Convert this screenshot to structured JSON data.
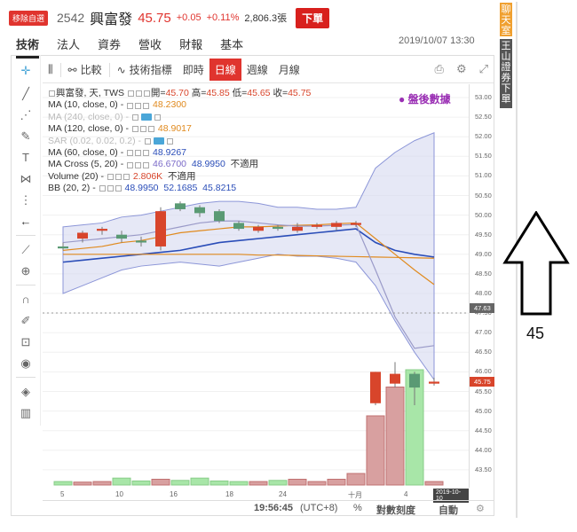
{
  "header": {
    "badge": "移除自選",
    "code": "2542",
    "name": "興富發",
    "price": "45.75",
    "change": "+0.05",
    "change_pct": "+0.11%",
    "volume": "2,806.3張",
    "order_button": "下單"
  },
  "tabs": [
    "技術",
    "法人",
    "資券",
    "營收",
    "財報",
    "基本"
  ],
  "active_tab": "技術",
  "timestamp": "2019/10/07 13:30",
  "toolbar": {
    "compare": "比較",
    "indicators": "技術指標",
    "intraday": "即時",
    "daily": "日線",
    "weekly": "週線",
    "monthly": "月線",
    "active": "日線"
  },
  "legend": {
    "main": {
      "title": "興富發, 天, TWS",
      "open_label": "開=",
      "open": "45.70",
      "high_label": "高=",
      "high": "45.85",
      "low_label": "低=",
      "low": "45.65",
      "close_label": "收=",
      "close": "45.75"
    },
    "rows": [
      {
        "label": "MA (10, close, 0)",
        "value": "48.2300",
        "color": "#e08a1e",
        "faded": false
      },
      {
        "label": "MA (240, close, 0)",
        "value": "",
        "faded": true
      },
      {
        "label": "MA (120, close, 0)",
        "value": "48.9017",
        "color": "#e08a1e",
        "faded": false
      },
      {
        "label": "SAR (0.02, 0.02, 0.2)",
        "value": "",
        "faded": true
      },
      {
        "label": "MA (60, close, 0)",
        "value": "48.9267",
        "color": "#2a4db8",
        "faded": false
      },
      {
        "label": "MA Cross (5, 20)",
        "value": "46.6700",
        "value2": "48.9950",
        "extra": "不適用",
        "faded": false
      },
      {
        "label": "Volume (20)",
        "value": "2.806K",
        "extra": "不適用",
        "faded": false
      },
      {
        "label": "BB (20, 2)",
        "value": "48.9950",
        "value2": "52.1685",
        "value3": "45.8215",
        "faded": false
      }
    ]
  },
  "after_hours": "盤後數據",
  "price_axis": [
    "53.00",
    "52.50",
    "52.00",
    "51.50",
    "51.00",
    "50.50",
    "50.00",
    "49.50",
    "49.00",
    "48.50",
    "48.00",
    "47.50",
    "47.00",
    "46.50",
    "46.00",
    "45.50",
    "45.00",
    "44.50",
    "44.00",
    "43.50"
  ],
  "price_axis_tags": {
    "crosshair": "47.63",
    "last": "45.75"
  },
  "time_axis": [
    "5",
    "10",
    "16",
    "18",
    "24",
    "十月",
    "4"
  ],
  "time_axis_tag": "2019-10-10",
  "bottombar": {
    "clock": "19:56:45",
    "tz": "(UTC+8)",
    "pct": "%",
    "log": "對數刻度",
    "auto": "自動"
  },
  "side_buttons": [
    "聊天室",
    "王山證券下單"
  ],
  "annotation": {
    "label": "45"
  },
  "colors": {
    "up": "#d8452b",
    "down": "#5a9a74",
    "accent": "#e0342e"
  },
  "chart_data": {
    "type": "candlestick",
    "candles": [
      {
        "o": 49.2,
        "h": 49.3,
        "l": 49.1,
        "c": 49.15
      },
      {
        "o": 49.4,
        "h": 49.6,
        "l": 49.3,
        "c": 49.55
      },
      {
        "o": 49.6,
        "h": 49.7,
        "l": 49.5,
        "c": 49.65
      },
      {
        "o": 49.5,
        "h": 49.6,
        "l": 49.3,
        "c": 49.4
      },
      {
        "o": 49.35,
        "h": 49.45,
        "l": 49.2,
        "c": 49.3
      },
      {
        "o": 49.2,
        "h": 50.2,
        "l": 49.1,
        "c": 50.1
      },
      {
        "o": 50.3,
        "h": 50.35,
        "l": 50.1,
        "c": 50.15
      },
      {
        "o": 50.2,
        "h": 50.25,
        "l": 49.95,
        "c": 50.05
      },
      {
        "o": 50.1,
        "h": 50.15,
        "l": 49.8,
        "c": 49.85
      },
      {
        "o": 49.8,
        "h": 49.85,
        "l": 49.6,
        "c": 49.65
      },
      {
        "o": 49.6,
        "h": 49.75,
        "l": 49.55,
        "c": 49.7
      },
      {
        "o": 49.7,
        "h": 49.75,
        "l": 49.6,
        "c": 49.65
      },
      {
        "o": 49.6,
        "h": 49.8,
        "l": 49.55,
        "c": 49.7
      },
      {
        "o": 49.7,
        "h": 49.8,
        "l": 49.65,
        "c": 49.75
      },
      {
        "o": 49.7,
        "h": 49.85,
        "l": 49.6,
        "c": 49.8
      },
      {
        "o": 49.75,
        "h": 49.85,
        "l": 49.7,
        "c": 49.8
      },
      {
        "o": 45.2,
        "h": 46.0,
        "l": 45.15,
        "c": 46.0
      },
      {
        "o": 45.7,
        "h": 46.25,
        "l": 45.6,
        "c": 45.95
      },
      {
        "o": 45.95,
        "h": 46.0,
        "l": 45.15,
        "c": 45.6
      },
      {
        "o": 45.7,
        "h": 45.85,
        "l": 45.65,
        "c": 45.75
      }
    ]
  }
}
